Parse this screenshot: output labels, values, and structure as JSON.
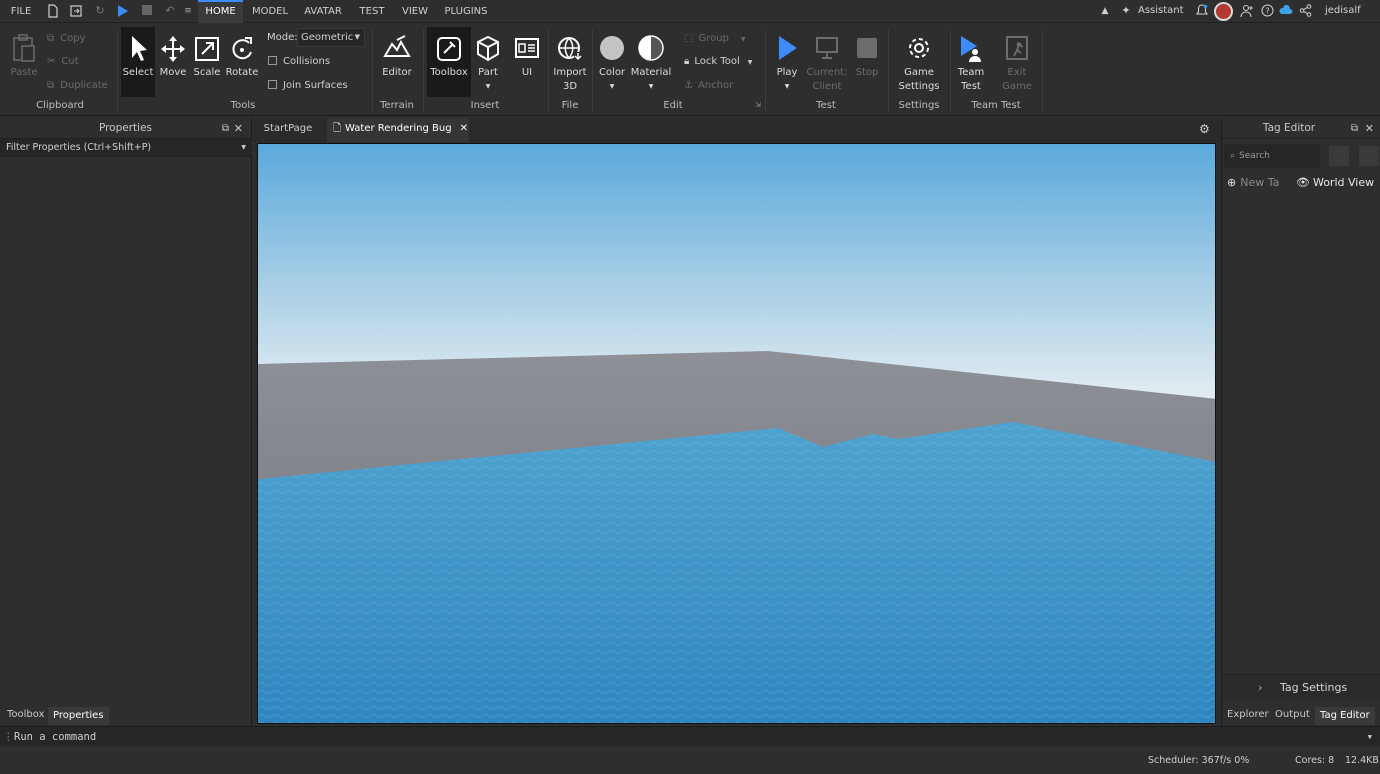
{
  "menubar": {
    "file": "FILE",
    "tabs": [
      "HOME",
      "MODEL",
      "AVATAR",
      "TEST",
      "VIEW",
      "PLUGINS"
    ],
    "active_tab": "HOME",
    "assistant": "Assistant",
    "username": "jedisalf"
  },
  "ribbon": {
    "clipboard": {
      "paste": "Paste",
      "copy": "Copy",
      "cut": "Cut",
      "duplicate": "Duplicate",
      "group": "Clipboard"
    },
    "tools": {
      "select": "Select",
      "move": "Move",
      "scale": "Scale",
      "rotate": "Rotate",
      "mode_label": "Mode:",
      "mode_value": "Geometric",
      "collisions": "Collisions",
      "join_surfaces": "Join Surfaces",
      "group": "Tools"
    },
    "terrain": {
      "editor": "Editor",
      "group": "Terrain"
    },
    "insert": {
      "toolbox": "Toolbox",
      "part": "Part",
      "ui": "UI",
      "group": "Insert"
    },
    "file": {
      "import_line1": "Import",
      "import_line2": "3D",
      "group": "File"
    },
    "edit": {
      "color": "Color",
      "material": "Material",
      "group_btn": "Group",
      "lock_tool": "Lock Tool",
      "anchor": "Anchor",
      "group": "Edit"
    },
    "test": {
      "play": "Play",
      "current_line1": "Current:",
      "current_line2": "Client",
      "stop": "Stop",
      "group": "Test"
    },
    "settings": {
      "line1": "Game",
      "line2": "Settings",
      "group": "Settings"
    },
    "team_test": {
      "team_line1": "Team",
      "team_line2": "Test",
      "exit_line1": "Exit",
      "exit_line2": "Game",
      "group": "Team Test"
    }
  },
  "properties": {
    "title": "Properties",
    "filter": "Filter Properties (Ctrl+Shift+P)",
    "bottom_tabs": [
      "Toolbox",
      "Properties"
    ]
  },
  "doc_tabs": {
    "start": "StartPage",
    "current": "Water Rendering Bug"
  },
  "tag_editor": {
    "title": "Tag Editor",
    "search_placeholder": "Search",
    "new_tag": "New Ta",
    "world_view": "World View",
    "tag_settings": "Tag Settings",
    "bottom_tabs": [
      "Explorer",
      "Output",
      "Tag Editor"
    ]
  },
  "command_bar": {
    "placeholder": "Run a command"
  },
  "status_bar": {
    "scheduler": "Scheduler: 367f/s 0%",
    "cores": "Cores: 8",
    "memory": "12.4KB"
  },
  "colors": {
    "accent": "#3c8cff",
    "sky_top": "#5aa9dc",
    "water": "#3a8fc6",
    "baseplate": "#7d7f86"
  }
}
